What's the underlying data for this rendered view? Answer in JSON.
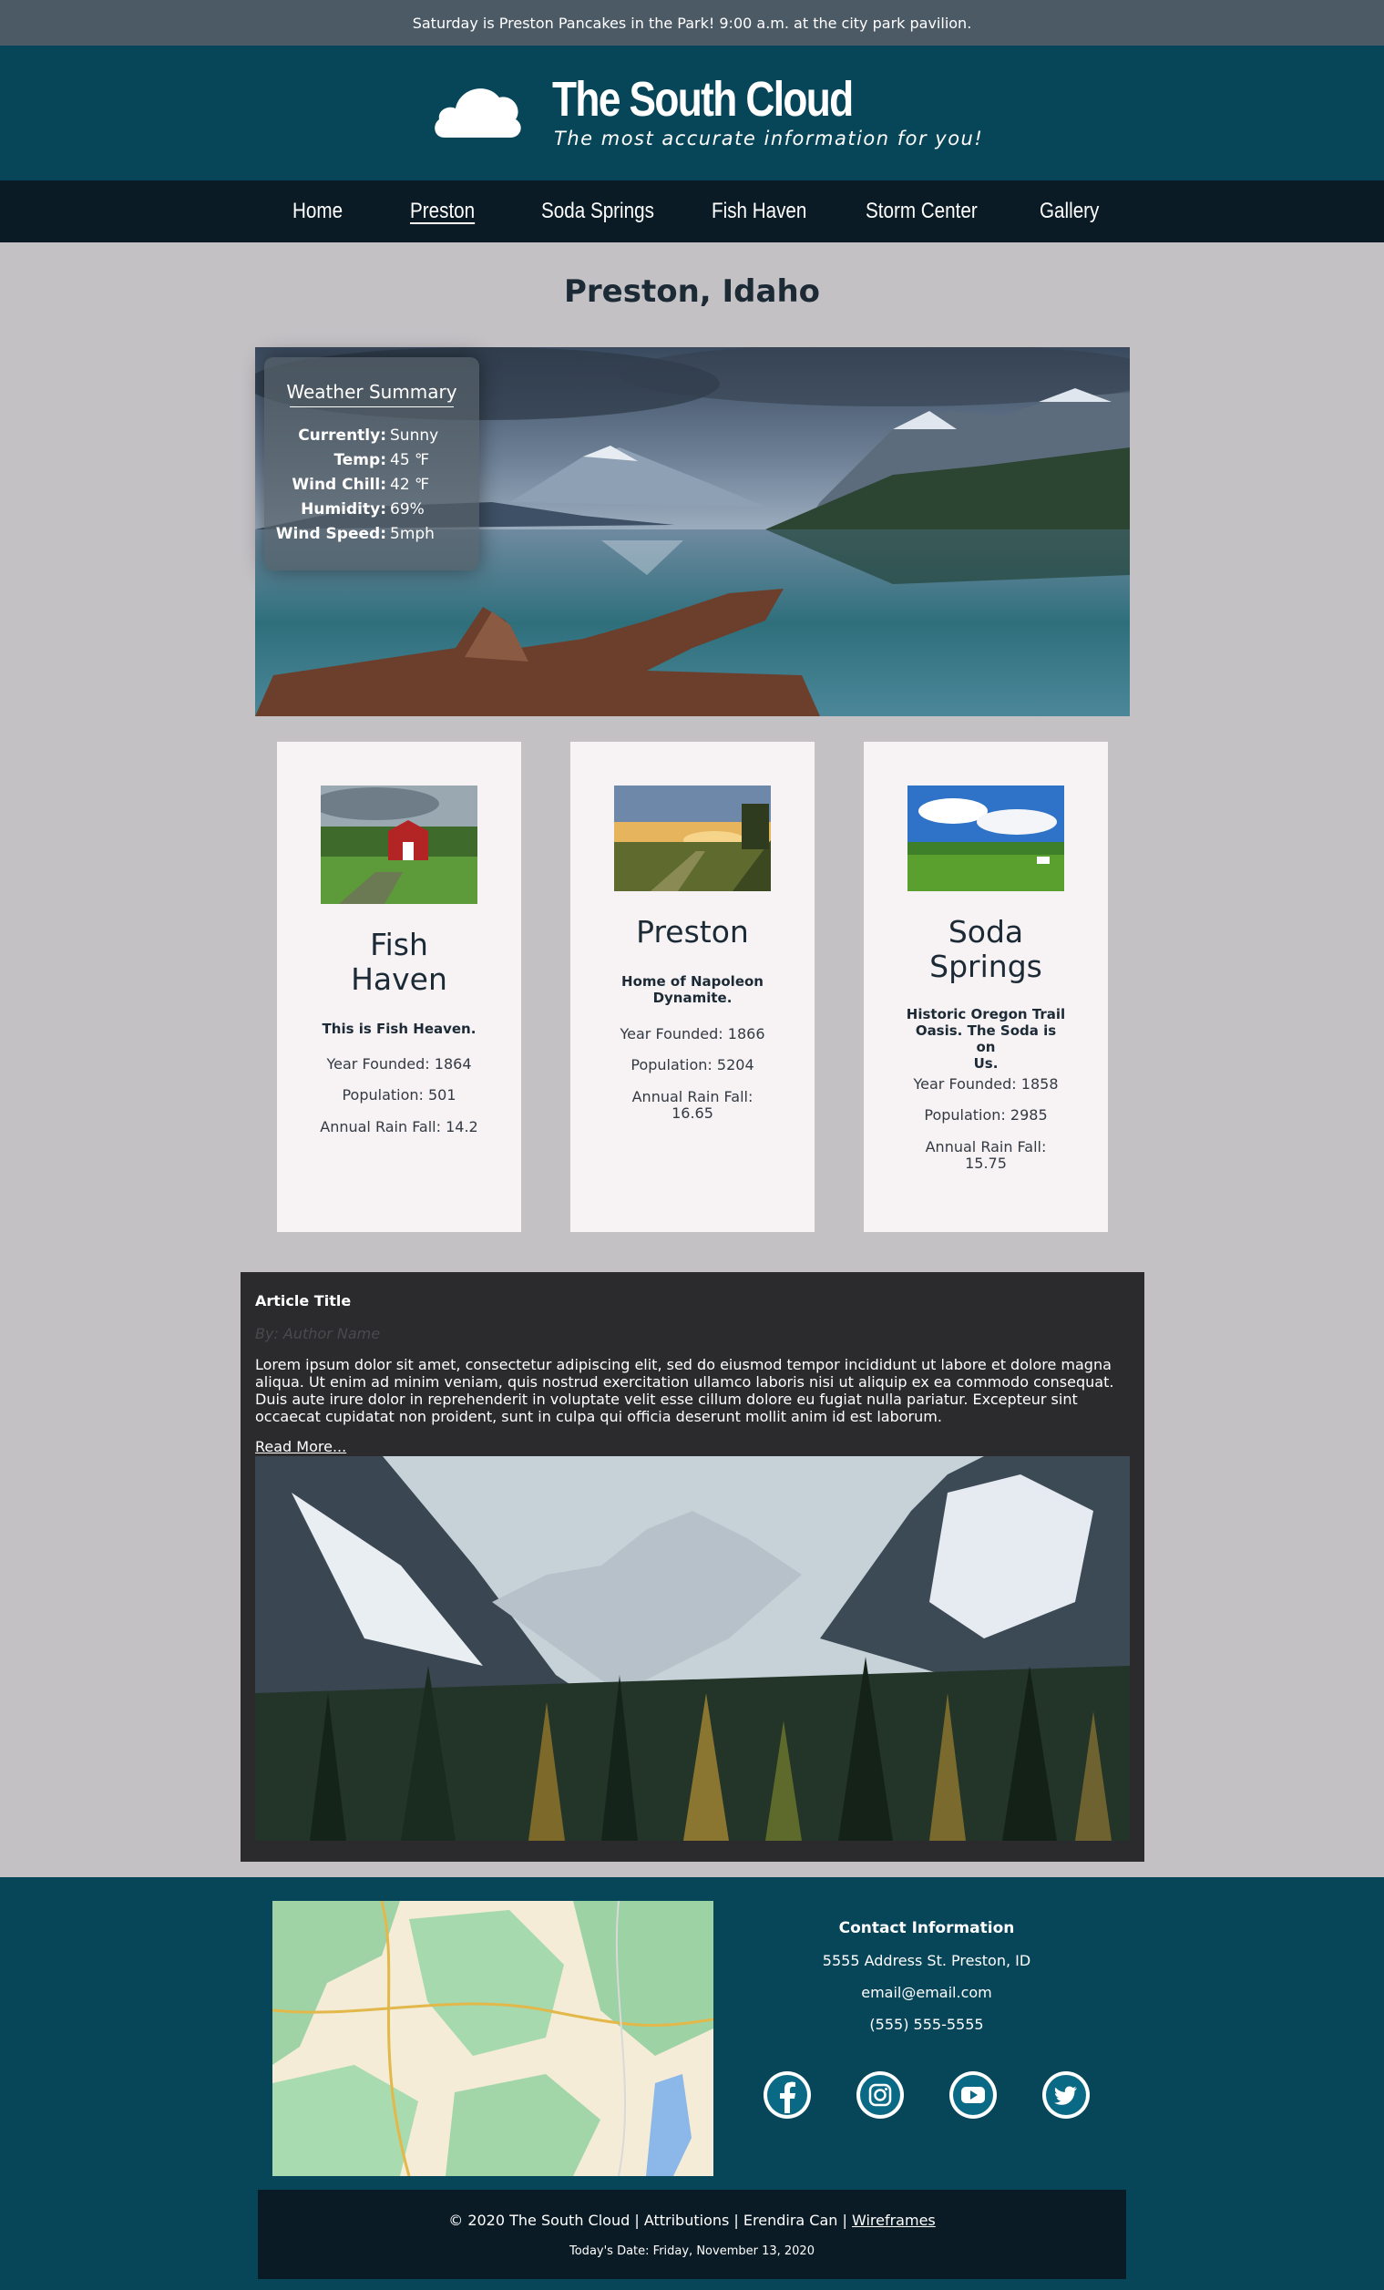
{
  "announcement": "Saturday is Preston Pancakes in the Park! 9:00 a.m. at the city park pavilion.",
  "header": {
    "title": "The South Cloud",
    "tagline": "The most accurate information for you!",
    "logo_icon": "cloud-icon"
  },
  "nav": {
    "items": [
      "Home",
      "Preston",
      "Soda Springs",
      "Fish Haven",
      "Storm Center",
      "Gallery"
    ],
    "active": "Preston"
  },
  "page": {
    "heading": "Preston, Idaho"
  },
  "weather": {
    "title": "Weather Summary",
    "rows": [
      {
        "label": "Currently:",
        "value": "Sunny"
      },
      {
        "label": "Temp:",
        "value": "45 ℉"
      },
      {
        "label": "Wind Chill:",
        "value": "42 ℉"
      },
      {
        "label": "Humidity:",
        "value": "69%"
      },
      {
        "label": "Wind Speed:",
        "value": "5mph"
      }
    ]
  },
  "towns": [
    {
      "name_line1": "Fish",
      "name_line2": "Haven",
      "motto": "This is Fish Heaven.",
      "year": "Year Founded: 1864",
      "population": "Population: 501",
      "rain": "Annual Rain Fall: 14.2"
    },
    {
      "name": "Preston",
      "motto_line1": "Home of Napoleon",
      "motto_line2": "Dynamite.",
      "year": "Year Founded: 1866",
      "population": "Population: 5204",
      "rain_line1": "Annual Rain Fall:",
      "rain_line2": "16.65"
    },
    {
      "name_line1": "Soda",
      "name_line2": "Springs",
      "motto_line1": "Historic Oregon Trail",
      "motto_line2": "Oasis. The Soda is on",
      "motto_line3": "Us.",
      "year": "Year Founded: 1858",
      "population": "Population: 2985",
      "rain_line1": "Annual Rain Fall:",
      "rain_line2": "15.75"
    }
  ],
  "article": {
    "title": "Article Title",
    "byline": "By: Author Name",
    "body": "Lorem ipsum dolor sit amet, consectetur adipiscing elit, sed do eiusmod tempor incididunt ut labore et dolore magna aliqua. Ut enim ad minim veniam, quis nostrud exercitation ullamco laboris nisi ut aliquip ex ea commodo consequat. Duis aute irure dolor in reprehenderit in voluptate velit esse cillum dolore eu fugiat nulla pariatur. Excepteur sint occaecat cupidatat non proident, sunt in culpa qui officia deserunt mollit anim id est laborum.",
    "read_more": "Read More..."
  },
  "footer": {
    "contact_title": "Contact Information",
    "address": "5555 Address St. Preston, ID",
    "email": "email@email.com",
    "phone": "(555) 555-5555",
    "social_icons": [
      "facebook-icon",
      "instagram-icon",
      "youtube-icon",
      "twitter-icon"
    ],
    "copyright": "© 2020 The South Cloud | Attributions | Erendira Can |",
    "wireframes": "Wireframes",
    "date": "Today's Date: Friday, November 13, 2020"
  },
  "colors": {
    "header_bg": "#074559",
    "nav_bg": "#0b1b26",
    "page_bg": "#c3c1c4",
    "card_bg": "#f7f3f5",
    "article_bg": "#2b2b2d",
    "social_accent": "#0a6a86"
  }
}
